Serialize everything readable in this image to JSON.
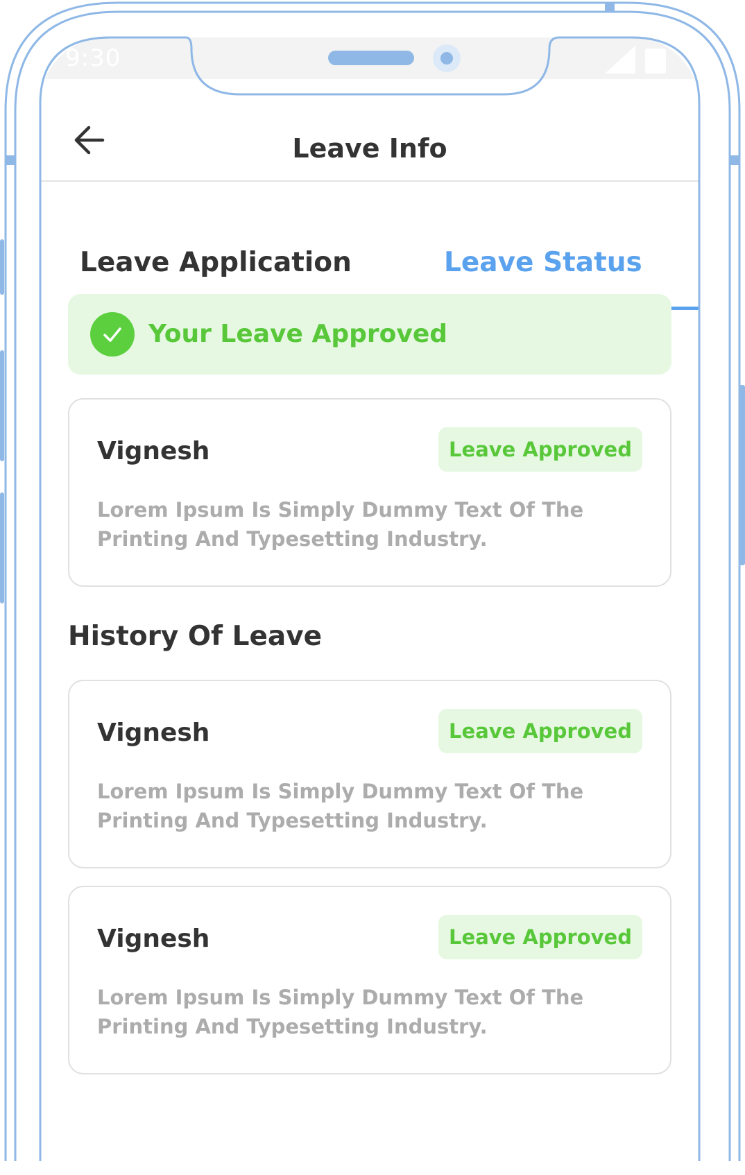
{
  "status_bar": {
    "time": "9:30",
    "icons": [
      "signal-icon",
      "battery-icon"
    ]
  },
  "header": {
    "back_icon": "arrow-left-icon",
    "title": "Leave Info"
  },
  "tabs": [
    {
      "label": "Leave Application",
      "active": false
    },
    {
      "label": "Leave Status",
      "active": true
    }
  ],
  "banner": {
    "icon": "check-circle-icon",
    "text": "Your Leave Approved"
  },
  "current_request": {
    "name": "Vignesh",
    "status": "Leave Approved",
    "description": "Lorem Ipsum Is Simply Dummy Text Of The Printing And Typesetting Industry."
  },
  "history": {
    "title": "History Of Leave",
    "items": [
      {
        "name": "Vignesh",
        "status": "Leave Approved",
        "description": "Lorem Ipsum Is Simply Dummy Text Of The Printing And Typesetting Industry."
      },
      {
        "name": "Vignesh",
        "status": "Leave Approved",
        "description": "Lorem Ipsum Is Simply Dummy Text Of The Printing And Typesetting Industry."
      }
    ]
  },
  "colors": {
    "accent": "#5aa2ee",
    "frame": "#8fb8e6",
    "success": "#58c83a",
    "success_bg": "#e6f8e1",
    "text_dark": "#333333",
    "text_muted": "#acacac"
  }
}
